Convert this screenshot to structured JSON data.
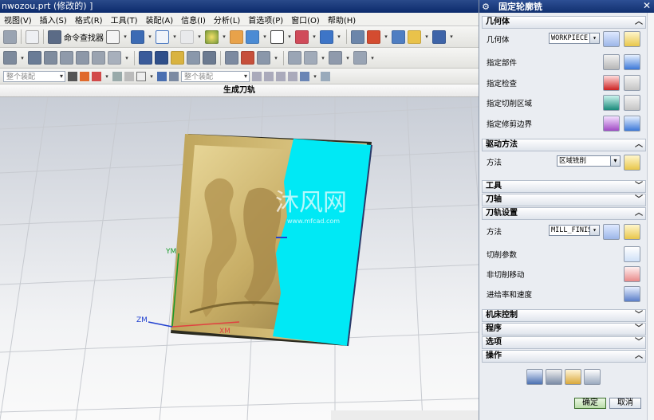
{
  "app": {
    "title": "nwozou.prt (修改的) ]"
  },
  "menu": [
    "视图(V)",
    "插入(S)",
    "格式(R)",
    "工具(T)",
    "装配(A)",
    "信息(I)",
    "分析(L)",
    "首选项(P)",
    "窗口(O)",
    "帮助(H)"
  ],
  "toolbar": {
    "command_finder": "命令查找器",
    "filter_select": "整个装配",
    "snap_select": "整个装配"
  },
  "graphics": {
    "header": "生成刀轨",
    "axis_ym": "YM",
    "axis_xm": "XM",
    "axis_zm": "ZM",
    "watermark_main": "沐风网",
    "watermark_url": "www.mfcad.com"
  },
  "dialog": {
    "title": "固定轮廓铣",
    "sections": {
      "geometry": {
        "header": "几何体",
        "geometry_label": "几何体",
        "geometry_value": "WORKPIECE",
        "specify_part": "指定部件",
        "specify_check": "指定检查",
        "specify_cut_area": "指定切削区域",
        "specify_trim": "指定修剪边界"
      },
      "drive": {
        "header": "驱动方法",
        "method_label": "方法",
        "method_value": "区域铣削"
      },
      "tool": {
        "header": "工具"
      },
      "axis": {
        "header": "刀轴"
      },
      "path_settings": {
        "header": "刀轨设置",
        "method_label": "方法",
        "method_value": "MILL_FINISH",
        "cut_params": "切削参数",
        "non_cut_moves": "非切削移动",
        "feeds_speeds": "进给率和速度"
      },
      "machine_control": {
        "header": "机床控制"
      },
      "program": {
        "header": "程序"
      },
      "options": {
        "header": "选项"
      },
      "actions": {
        "header": "操作"
      }
    },
    "ok": "确定",
    "cancel": "取消"
  }
}
